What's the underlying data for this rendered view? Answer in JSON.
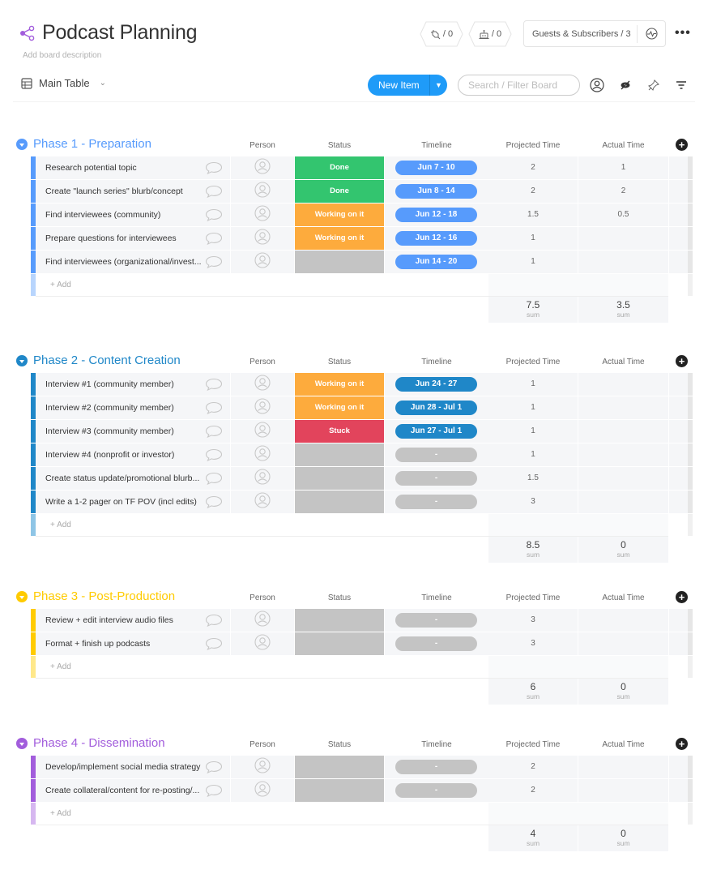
{
  "header": {
    "title": "Podcast Planning",
    "description_placeholder": "Add board description",
    "view_label": "Main Table",
    "integrations_count": "/ 0",
    "automations_count": "/ 0",
    "guests_label": "Guests & Subscribers / 3",
    "new_item_label": "New Item",
    "search_placeholder": "Search / Filter Board"
  },
  "columns": {
    "person": "Person",
    "status": "Status",
    "timeline": "Timeline",
    "projected": "Projected Time",
    "actual": "Actual Time"
  },
  "add_label": "+ Add",
  "sum_label": "sum",
  "colors": {
    "done": "#33c56f",
    "working": "#fdab3d",
    "stuck": "#e2445c",
    "empty": "#c4c4c4",
    "tl_light": "#579bfc",
    "tl_dark": "#1f87c8"
  },
  "groups": [
    {
      "title": "Phase 1 - Preparation",
      "color": "#579bfc",
      "bar_light": "#b8d5fd",
      "tl_color": "#579bfc",
      "items": [
        {
          "name": "Research potential topic",
          "status": "Done",
          "status_key": "done",
          "timeline": "Jun 7 - 10",
          "projected": "2",
          "actual": "1"
        },
        {
          "name": "Create \"launch series\" blurb/concept",
          "status": "Done",
          "status_key": "done",
          "timeline": "Jun 8 - 14",
          "projected": "2",
          "actual": "2"
        },
        {
          "name": "Find interviewees (community)",
          "status": "Working on it",
          "status_key": "working",
          "timeline": "Jun 12 - 18",
          "projected": "1.5",
          "actual": "0.5"
        },
        {
          "name": "Prepare questions for interviewees",
          "status": "Working on it",
          "status_key": "working",
          "timeline": "Jun 12 - 16",
          "projected": "1",
          "actual": ""
        },
        {
          "name": "Find interviewees (organizational/invest...",
          "status": "",
          "status_key": "empty",
          "timeline": "Jun 14 - 20",
          "projected": "1",
          "actual": ""
        }
      ],
      "sum_projected": "7.5",
      "sum_actual": "3.5"
    },
    {
      "title": "Phase 2 - Content Creation",
      "color": "#1f87c8",
      "bar_light": "#8ec5e6",
      "tl_color": "#1f87c8",
      "items": [
        {
          "name": "Interview #1 (community member)",
          "status": "Working on it",
          "status_key": "working",
          "timeline": "Jun 24 - 27",
          "projected": "1",
          "actual": ""
        },
        {
          "name": "Interview #2 (community member)",
          "status": "Working on it",
          "status_key": "working",
          "timeline": "Jun 28 - Jul 1",
          "projected": "1",
          "actual": ""
        },
        {
          "name": "Interview #3 (community member)",
          "status": "Stuck",
          "status_key": "stuck",
          "timeline": "Jun 27 - Jul 1",
          "projected": "1",
          "actual": ""
        },
        {
          "name": "Interview #4 (nonprofit or investor)",
          "status": "",
          "status_key": "empty",
          "timeline": "-",
          "projected": "1",
          "actual": ""
        },
        {
          "name": "Create status update/promotional blurb...",
          "status": "",
          "status_key": "empty",
          "timeline": "-",
          "projected": "1.5",
          "actual": ""
        },
        {
          "name": "Write a 1-2 pager on TF POV (incl edits)",
          "status": "",
          "status_key": "empty",
          "timeline": "-",
          "projected": "3",
          "actual": ""
        }
      ],
      "sum_projected": "8.5",
      "sum_actual": "0"
    },
    {
      "title": "Phase 3 - Post-Production",
      "color": "#ffcb00",
      "bar_light": "#ffe88a",
      "tl_color": "#c4c4c4",
      "items": [
        {
          "name": "Review + edit interview audio files",
          "status": "",
          "status_key": "empty",
          "timeline": "-",
          "projected": "3",
          "actual": ""
        },
        {
          "name": "Format + finish up podcasts",
          "status": "",
          "status_key": "empty",
          "timeline": "-",
          "projected": "3",
          "actual": ""
        }
      ],
      "sum_projected": "6",
      "sum_actual": "0"
    },
    {
      "title": "Phase 4 - Dissemination",
      "color": "#a25ddc",
      "bar_light": "#d6b7f0",
      "tl_color": "#c4c4c4",
      "items": [
        {
          "name": "Develop/implement social media strategy",
          "status": "",
          "status_key": "empty",
          "timeline": "-",
          "projected": "2",
          "actual": ""
        },
        {
          "name": "Create collateral/content for re-posting/...",
          "status": "",
          "status_key": "empty",
          "timeline": "-",
          "projected": "2",
          "actual": ""
        }
      ],
      "sum_projected": "4",
      "sum_actual": "0"
    }
  ]
}
